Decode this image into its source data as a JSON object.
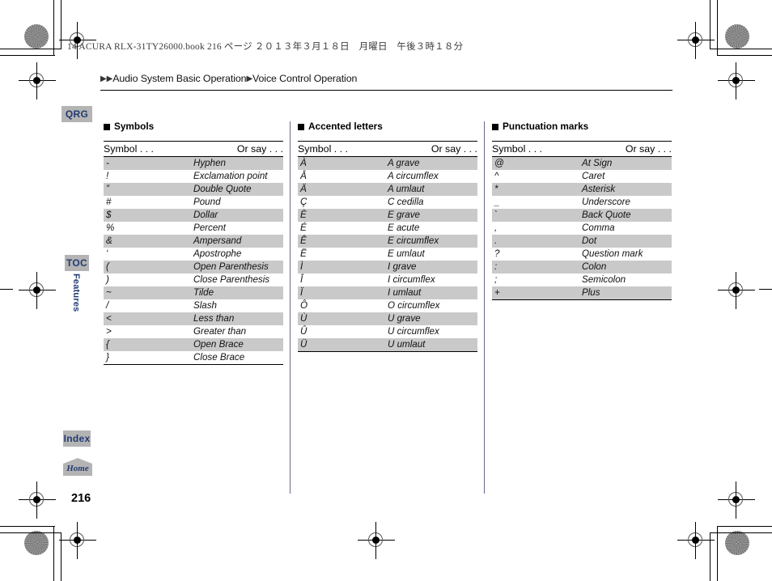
{
  "header": {
    "book_line": "14 ACURA RLX-31TY26000.book   216 ページ   ２０１３年３月１８日　月曜日　午後３時１８分",
    "breadcrumb_marker": "▶",
    "breadcrumb_part1": "Audio System Basic Operation",
    "breadcrumb_part2": "Voice Control Operation"
  },
  "sidebar": {
    "qrg_label": "QRG",
    "toc_label": "TOC",
    "features_label": "Features",
    "index_label": "Index",
    "home_label": "Home"
  },
  "page_number": "216",
  "columns": [
    {
      "title": "Symbols",
      "header_symbol": "Symbol . . .",
      "header_orsay": "Or say . . .",
      "rows": [
        {
          "symbol": "-",
          "say": "Hyphen"
        },
        {
          "symbol": "!",
          "say": "Exclamation point"
        },
        {
          "symbol": "”",
          "say": "Double Quote"
        },
        {
          "symbol": "#",
          "say": "Pound"
        },
        {
          "symbol": "$",
          "say": "Dollar"
        },
        {
          "symbol": "%",
          "say": "Percent"
        },
        {
          "symbol": "&",
          "say": "Ampersand"
        },
        {
          "symbol": "‘",
          "say": "Apostrophe"
        },
        {
          "symbol": "(",
          "say": "Open Parenthesis"
        },
        {
          "symbol": ")",
          "say": "Close Parenthesis"
        },
        {
          "symbol": "~",
          "say": "Tilde"
        },
        {
          "symbol": "/",
          "say": "Slash"
        },
        {
          "symbol": "<",
          "say": "Less than"
        },
        {
          "symbol": ">",
          "say": "Greater than"
        },
        {
          "symbol": "{",
          "say": "Open Brace"
        },
        {
          "symbol": "}",
          "say": "Close Brace"
        }
      ]
    },
    {
      "title": "Accented letters",
      "header_symbol": "Symbol . . .",
      "header_orsay": "Or say . . .",
      "rows": [
        {
          "symbol": "À",
          "say": "A grave"
        },
        {
          "symbol": "Â",
          "say": "A circumflex"
        },
        {
          "symbol": "Ä",
          "say": "A umlaut"
        },
        {
          "symbol": "Ç",
          "say": "C cedilla"
        },
        {
          "symbol": "È",
          "say": "E grave"
        },
        {
          "symbol": "É",
          "say": "E acute"
        },
        {
          "symbol": "Ê",
          "say": "E circumflex"
        },
        {
          "symbol": "Ë",
          "say": "E umlaut"
        },
        {
          "symbol": "Ì",
          "say": "I grave"
        },
        {
          "symbol": "Î",
          "say": "I circumflex"
        },
        {
          "symbol": "Ï",
          "say": "I umlaut"
        },
        {
          "symbol": "Ô",
          "say": "O circumflex"
        },
        {
          "symbol": "Ù",
          "say": "U grave"
        },
        {
          "symbol": "Û",
          "say": "U circumflex"
        },
        {
          "symbol": "Ü",
          "say": "U umlaut"
        }
      ]
    },
    {
      "title": "Punctuation marks",
      "header_symbol": "Symbol . . .",
      "header_orsay": "Or say . . .",
      "rows": [
        {
          "symbol": "@",
          "say": "At Sign"
        },
        {
          "symbol": "^",
          "say": "Caret"
        },
        {
          "symbol": "*",
          "say": "Asterisk"
        },
        {
          "symbol": "_",
          "say": "Underscore"
        },
        {
          "symbol": "`",
          "say": "Back Quote"
        },
        {
          "symbol": ",",
          "say": "Comma"
        },
        {
          "symbol": ".",
          "say": "Dot"
        },
        {
          "symbol": "?",
          "say": "Question mark"
        },
        {
          "symbol": ":",
          "say": "Colon"
        },
        {
          "symbol": ";",
          "say": "Semicolon"
        },
        {
          "symbol": "+",
          "say": "Plus"
        }
      ]
    }
  ],
  "colors": {
    "tab_bg": "#b4b4b4",
    "tab_text": "#233b73",
    "row_shade": "#c9c9c9",
    "rule": "#000000"
  }
}
